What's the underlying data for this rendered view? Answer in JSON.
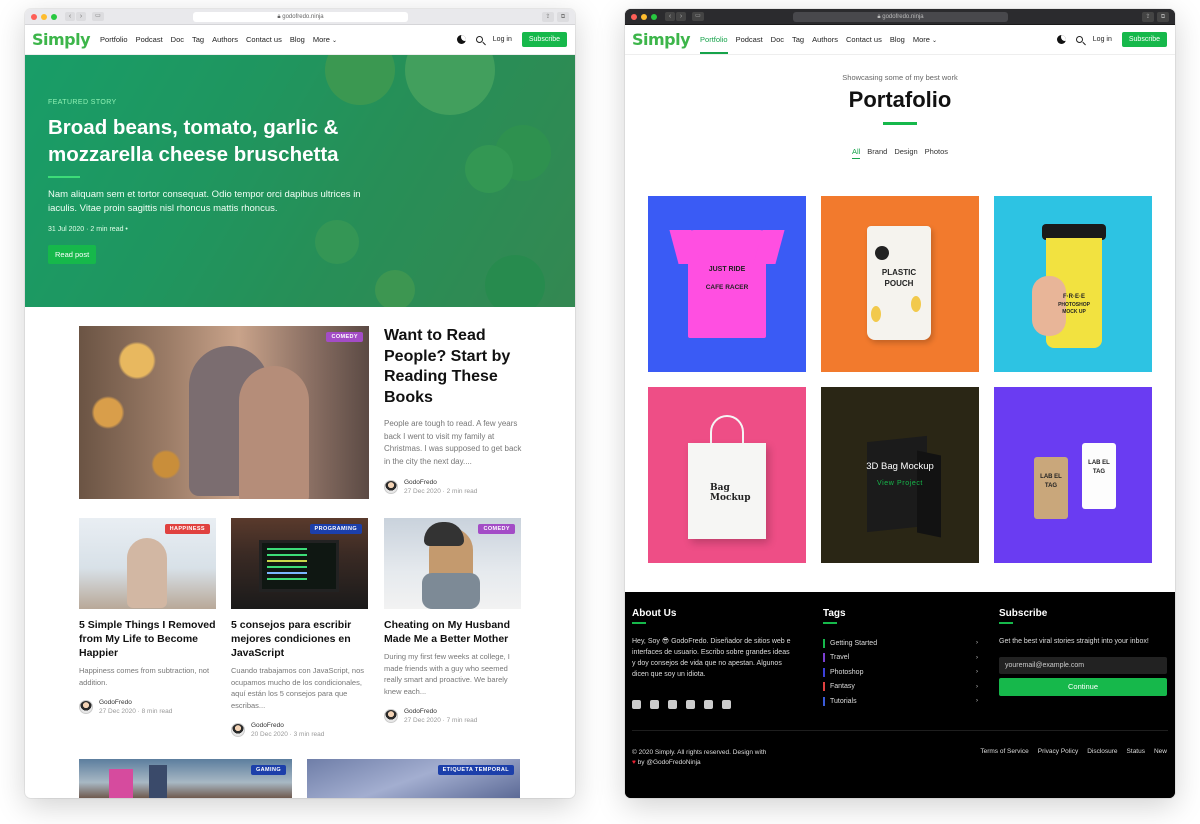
{
  "left": {
    "url": "godofredo.ninja",
    "logo": "Simply",
    "nav": [
      "Portfolio",
      "Podcast",
      "Doc",
      "Tag",
      "Authors",
      "Contact us",
      "Blog",
      "More"
    ],
    "login": "Log in",
    "subscribe": "Subscribe",
    "hero": {
      "eyebrow": "FEATURED STORY",
      "title": "Broad beans, tomato, garlic & mozzarella cheese bruschetta",
      "text": "Nam aliquam sem et tortor consequat. Odio tempor orci dapibus ultrices in iaculis. Vitae proin sagittis nisl rhoncus mattis rhoncus.",
      "meta": "31 Jul 2020 · 2 min read •",
      "button": "Read post"
    },
    "featured": {
      "tag": "COMEDY",
      "title": "Want to Read People? Start by Reading These Books",
      "excerpt": "People are tough to read. A few years back I went to visit my family at Christmas. I was supposed to get back in the city the next day....",
      "author": "GodoFredo",
      "meta": "27 Dec 2020 · 2 min read"
    },
    "cards": [
      {
        "tag": "HAPPINESS",
        "tag_color": "#e0413f",
        "title": "5 Simple Things I Removed from My Life to Become Happier",
        "excerpt": "Happiness comes from subtraction, not addition.",
        "author": "GodoFredo",
        "meta": "27 Dec 2020 · 8 min read"
      },
      {
        "tag": "PROGRAMING",
        "tag_color": "#1c3faa",
        "title": "5 consejos para escribir mejores condiciones en JavaScript",
        "excerpt": "Cuando trabajamos con JavaScript, nos ocupamos mucho de los condicionales, aquí están los 5 consejos para que escribas...",
        "author": "GodoFredo",
        "meta": "20 Dec 2020 · 3 min read"
      },
      {
        "tag": "COMEDY",
        "tag_color": "#a34cc6",
        "title": "Cheating on My Husband Made Me a Better Mother",
        "excerpt": "During my first few weeks at college, I made friends with a guy who seemed really smart and proactive. We barely knew each...",
        "author": "GodoFredo",
        "meta": "27 Dec 2020 · 7 min read"
      }
    ],
    "bottom_tags": [
      "GAMING",
      "ETIQUETA TEMPORAL"
    ]
  },
  "right": {
    "url": "godofredo.ninja",
    "logo": "Simply",
    "nav": [
      "Portfolio",
      "Podcast",
      "Doc",
      "Tag",
      "Authors",
      "Contact us",
      "Blog",
      "More"
    ],
    "login": "Log in",
    "subscribe": "Subscribe",
    "subtitle": "Showcasing some of my best work",
    "title": "Portafolio",
    "filters": [
      "All",
      "Brand",
      "Design",
      "Photos"
    ],
    "tiles": {
      "tshirt": {
        "line1": "JUST RIDE",
        "line2": "CAFE RACER"
      },
      "pouch": {
        "line1": "PLASTIC",
        "line2": "POUCH"
      },
      "cup": {
        "line1": "F·R·E·E",
        "line2": "PHOTOSHOP",
        "line3": "MOCK UP"
      },
      "bag": {
        "line1": "Bag",
        "line2": "Mockup"
      },
      "hover": {
        "title": "3D Bag Mockup",
        "link": "View Project"
      },
      "labels": {
        "text": "LAB EL TAG"
      }
    },
    "footer": {
      "about_title": "About Us",
      "about_text": "Hey, Soy 😎 GodoFredo. Diseñador de sitios web e interfaces de usuario. Escribo sobre grandes ideas y doy consejos de vida que no apestan. Algunos dicen que soy un idiota.",
      "tags_title": "Tags",
      "tags": [
        {
          "name": "Getting Started",
          "color": "#16b84b"
        },
        {
          "name": "Travel",
          "color": "#7a3fd0"
        },
        {
          "name": "Photoshop",
          "color": "#3b3fd8"
        },
        {
          "name": "Fantasy",
          "color": "#e0413f"
        },
        {
          "name": "Tutorials",
          "color": "#3b5bd8"
        }
      ],
      "subscribe_title": "Subscribe",
      "subscribe_text": "Get the best viral stories straight into your inbox!",
      "email_placeholder": "youremail@example.com",
      "continue": "Continue",
      "copyright_1": "© 2020 Simply. All rights reserved. Design with",
      "copyright_2": "by @GodoFredoNinja",
      "links": [
        "Terms of Service",
        "Privacy Policy",
        "Disclosure",
        "Status",
        "New"
      ]
    }
  },
  "colors": {
    "accent": "#16b84b",
    "dark": "#000000"
  }
}
